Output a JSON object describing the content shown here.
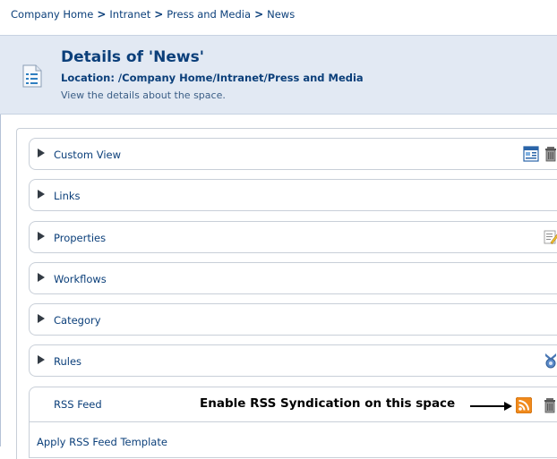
{
  "breadcrumb": {
    "items": [
      "Company Home",
      "Intranet",
      "Press and Media",
      "News"
    ],
    "separator": ">"
  },
  "header": {
    "title": "Details of 'News'",
    "location": "Location: /Company Home/Intranet/Press and Media",
    "description": "View the details about the space.",
    "icon": "space-details-icon"
  },
  "panels": [
    {
      "label": "Custom View",
      "icons": [
        "custom-view-icon",
        "delete-icon"
      ]
    },
    {
      "label": "Links",
      "icons": []
    },
    {
      "label": "Properties",
      "icons": [
        "edit-properties-icon"
      ]
    },
    {
      "label": "Workflows",
      "icons": []
    },
    {
      "label": "Category",
      "icons": []
    },
    {
      "label": "Rules",
      "icons": [
        "rules-icon"
      ]
    }
  ],
  "rss": {
    "label": "RSS Feed",
    "annotation": "Enable RSS Syndication on this space",
    "apply_link": "Apply RSS Feed Template",
    "icons": [
      "rss-icon",
      "delete-icon"
    ]
  },
  "colors": {
    "link": "#0b3f7a",
    "header_bg": "#e2e9f3",
    "rss_orange": "#f08a1c"
  }
}
